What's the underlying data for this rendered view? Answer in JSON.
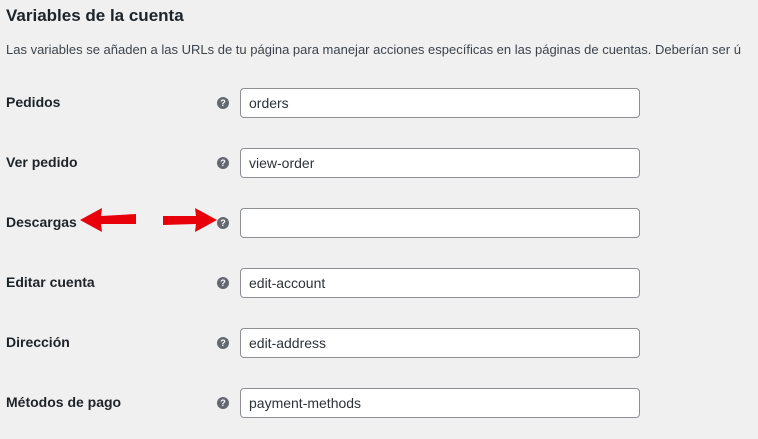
{
  "section": {
    "title": "Variables de la cuenta",
    "description": "Las variables se añaden a las URLs de tu página para manejar acciones específicas en las páginas de cuentas. Deberían ser ú"
  },
  "help_icon": {
    "glyph": "?",
    "icon": "help-icon"
  },
  "fields": [
    {
      "label": "Pedidos",
      "value": "orders"
    },
    {
      "label": "Ver pedido",
      "value": "view-order"
    },
    {
      "label": "Descargas",
      "value": ""
    },
    {
      "label": "Editar cuenta",
      "value": "edit-account"
    },
    {
      "label": "Dirección",
      "value": "edit-address"
    },
    {
      "label": "Métodos de pago",
      "value": "payment-methods"
    }
  ],
  "colors": {
    "background": "#f0f0f1",
    "input_border": "#8c8f94",
    "help_icon": "#646970",
    "annotation_arrow": "#e8000b"
  }
}
